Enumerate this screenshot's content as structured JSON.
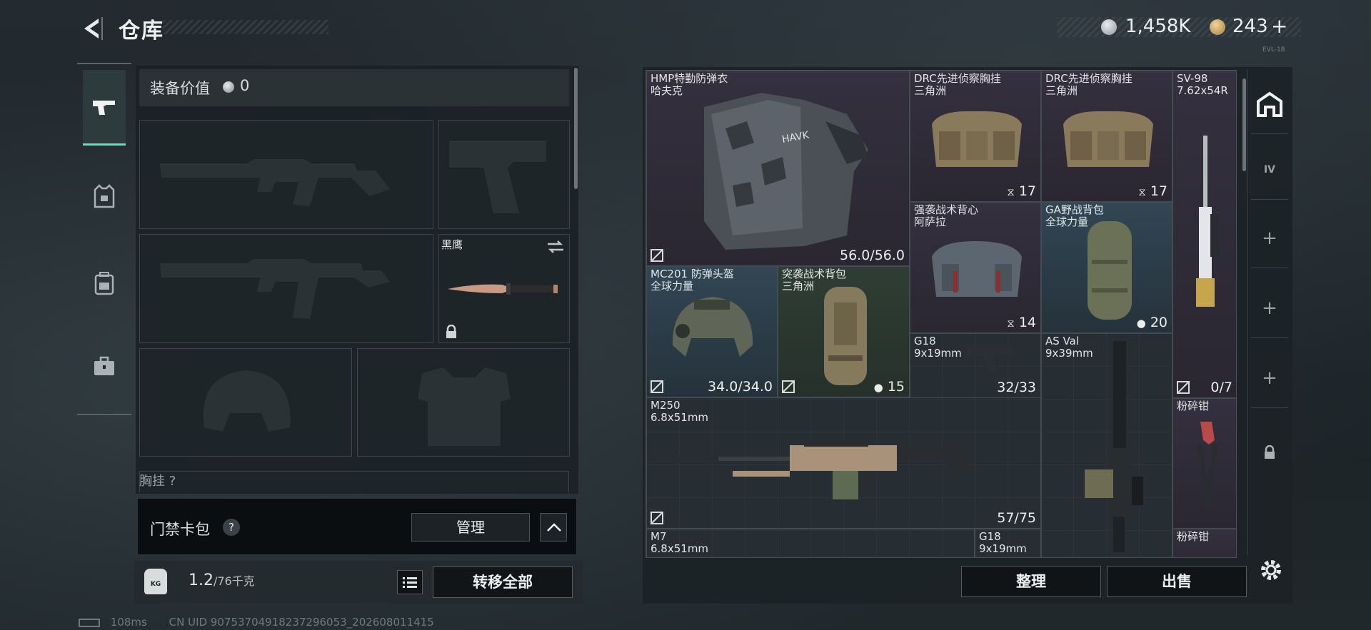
{
  "header": {
    "title": "仓库",
    "currency1": "1,458K",
    "currency2": "243",
    "currency2_suffix": "+",
    "version": "EVL-18"
  },
  "loadout": {
    "value_label": "装备价值",
    "value": "0",
    "knife_name": "黑鹰",
    "chest_label": "胸挂",
    "chest_help": "?",
    "keycard_label": "门禁卡包",
    "keycard_help": "?",
    "manage_button": "管理",
    "weight_current": "1.2",
    "weight_total": "/76千克",
    "weight_icon_text": "KG",
    "transfer_all_button": "转移全部"
  },
  "status_bar": {
    "ping": "108ms",
    "uid": "CN UID 90753704918237296053_202608011415"
  },
  "stash": {
    "items": [
      {
        "name": "HMP特勤防弹衣",
        "sub": "哈夫克",
        "value": "56.0/56.0"
      },
      {
        "name": "DRC先进侦察胸挂",
        "sub": "三角洲",
        "value": "17"
      },
      {
        "name": "DRC先进侦察胸挂",
        "sub": "三角洲",
        "value": "17"
      },
      {
        "name": "SV-98",
        "sub": "7.62x54R",
        "value": "0/7"
      },
      {
        "name": "强袭战术背心",
        "sub": "阿萨拉",
        "value": "14"
      },
      {
        "name": "GA野战背包",
        "sub": "全球力量",
        "value": "20"
      },
      {
        "name": "MC201 防弹头盔",
        "sub": "全球力量",
        "value": "34.0/34.0"
      },
      {
        "name": "突袭战术背包",
        "sub": "三角洲",
        "value": "15"
      },
      {
        "name": "G18",
        "sub": "9x19mm",
        "value": "32/33"
      },
      {
        "name": "AS Val",
        "sub": "9x39mm",
        "value": ""
      },
      {
        "name": "M250",
        "sub": "6.8x51mm",
        "value": "57/75"
      },
      {
        "name": "粉碎钳",
        "sub": "",
        "value": ""
      },
      {
        "name": "M7",
        "sub": "6.8x51mm",
        "value": ""
      },
      {
        "name": "G18",
        "sub": "9x19mm",
        "value": ""
      },
      {
        "name": "粉碎钳",
        "sub": "",
        "value": ""
      }
    ],
    "sort_button": "整理",
    "sell_button": "出售",
    "sidebar_plus": "+",
    "sidebar_label_iv": "IV"
  },
  "colors": {
    "accent": "#6fd7b5",
    "rarity_blue": "#324654",
    "rarity_green": "#2f3e34",
    "rarity_purple": "#34303f"
  }
}
